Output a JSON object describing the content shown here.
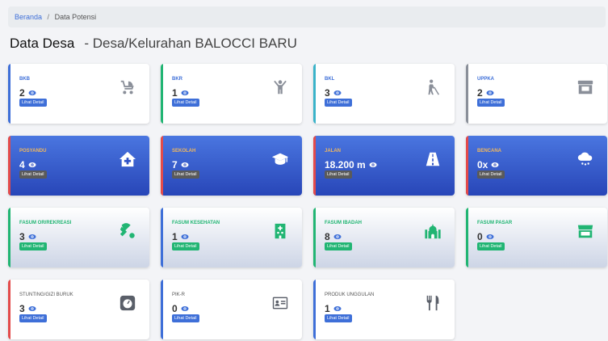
{
  "breadcrumb": {
    "home": "Beranda",
    "separator": "/",
    "current": "Data Potensi"
  },
  "page": {
    "title": "Data Desa",
    "subtitle": "- Desa/Kelurahan BALOCCI BARU"
  },
  "detail_label": "Lihat Detail",
  "colors": {
    "blue": "#3e6fd8",
    "green": "#21b573",
    "red": "#e34b4b",
    "gray": "#8a8f99",
    "orange": "#f0b75d"
  },
  "cards": [
    {
      "label": "BKB",
      "value": "2",
      "icon": "stroller-icon"
    },
    {
      "label": "BKR",
      "value": "1",
      "icon": "person-arms-up-icon"
    },
    {
      "label": "BKL",
      "value": "3",
      "icon": "elderly-cane-icon"
    },
    {
      "label": "UPPKA",
      "value": "2",
      "icon": "store-icon"
    },
    {
      "label": "POSYANDU",
      "value": "4",
      "icon": "clinic-house-icon"
    },
    {
      "label": "SEKOLAH",
      "value": "7",
      "icon": "graduation-cap-icon"
    },
    {
      "label": "JALAN",
      "value": "18.200 m",
      "icon": "road-icon"
    },
    {
      "label": "BENCANA",
      "value": "0x",
      "icon": "cloud-rain-icon"
    },
    {
      "label": "FASUM OR/REKREASI",
      "value": "3",
      "icon": "table-tennis-icon"
    },
    {
      "label": "FASUM KESEHATAN",
      "value": "1",
      "icon": "hospital-icon"
    },
    {
      "label": "FASUM IBADAH",
      "value": "8",
      "icon": "mosque-icon"
    },
    {
      "label": "FASUM PASAR",
      "value": "0",
      "icon": "market-icon"
    },
    {
      "label": "STUNTING/GIZI BURUK",
      "value": "3",
      "icon": "scale-icon"
    },
    {
      "label": "PIK-R",
      "value": "0",
      "icon": "id-card-icon"
    },
    {
      "label": "PRODUK UNGGULAN",
      "value": "1",
      "icon": "utensils-icon"
    }
  ]
}
